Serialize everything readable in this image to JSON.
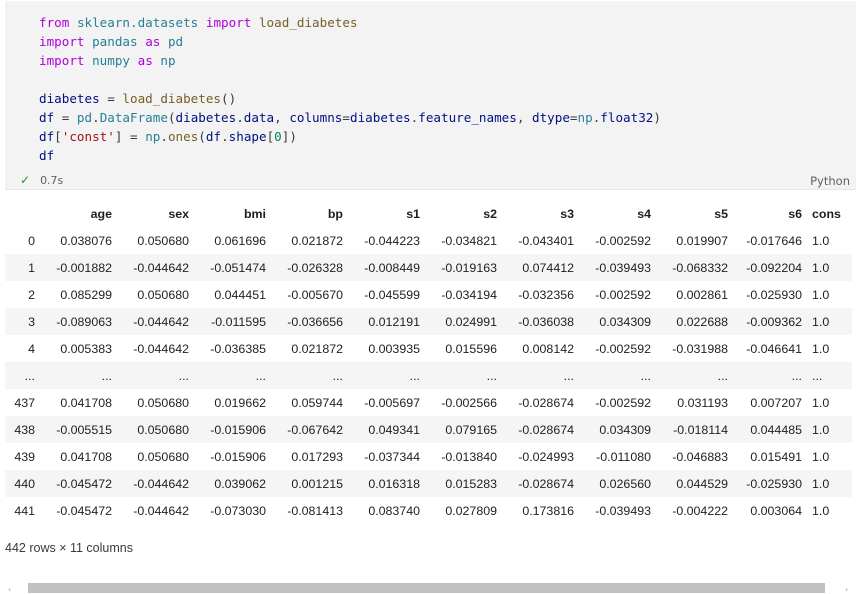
{
  "code_cell": {
    "lines": [
      "from sklearn.datasets import load_diabetes",
      "import pandas as pd",
      "import numpy as np",
      "",
      "diabetes = load_diabetes()",
      "df = pd.DataFrame(diabetes.data, columns=diabetes.feature_names, dtype=np.float32)",
      "df['const'] = np.ones(df.shape[0])",
      "df"
    ],
    "exec_time": "0.7s",
    "language": "Python"
  },
  "table": {
    "columns": [
      "age",
      "sex",
      "bmi",
      "bp",
      "s1",
      "s2",
      "s3",
      "s4",
      "s5",
      "s6",
      "cons"
    ],
    "rows": [
      [
        "0",
        "0.038076",
        "0.050680",
        "0.061696",
        "0.021872",
        "-0.044223",
        "-0.034821",
        "-0.043401",
        "-0.002592",
        "0.019907",
        "-0.017646",
        "1.0"
      ],
      [
        "1",
        "-0.001882",
        "-0.044642",
        "-0.051474",
        "-0.026328",
        "-0.008449",
        "-0.019163",
        "0.074412",
        "-0.039493",
        "-0.068332",
        "-0.092204",
        "1.0"
      ],
      [
        "2",
        "0.085299",
        "0.050680",
        "0.044451",
        "-0.005670",
        "-0.045599",
        "-0.034194",
        "-0.032356",
        "-0.002592",
        "0.002861",
        "-0.025930",
        "1.0"
      ],
      [
        "3",
        "-0.089063",
        "-0.044642",
        "-0.011595",
        "-0.036656",
        "0.012191",
        "0.024991",
        "-0.036038",
        "0.034309",
        "0.022688",
        "-0.009362",
        "1.0"
      ],
      [
        "4",
        "0.005383",
        "-0.044642",
        "-0.036385",
        "0.021872",
        "0.003935",
        "0.015596",
        "0.008142",
        "-0.002592",
        "-0.031988",
        "-0.046641",
        "1.0"
      ],
      [
        "...",
        "...",
        "...",
        "...",
        "...",
        "...",
        "...",
        "...",
        "...",
        "...",
        "...",
        "..."
      ],
      [
        "437",
        "0.041708",
        "0.050680",
        "0.019662",
        "0.059744",
        "-0.005697",
        "-0.002566",
        "-0.028674",
        "-0.002592",
        "0.031193",
        "0.007207",
        "1.0"
      ],
      [
        "438",
        "-0.005515",
        "0.050680",
        "-0.015906",
        "-0.067642",
        "0.049341",
        "0.079165",
        "-0.028674",
        "0.034309",
        "-0.018114",
        "0.044485",
        "1.0"
      ],
      [
        "439",
        "0.041708",
        "0.050680",
        "-0.015906",
        "0.017293",
        "-0.037344",
        "-0.013840",
        "-0.024993",
        "-0.011080",
        "-0.046883",
        "0.015491",
        "1.0"
      ],
      [
        "440",
        "-0.045472",
        "-0.044642",
        "0.039062",
        "0.001215",
        "0.016318",
        "0.015283",
        "-0.028674",
        "0.026560",
        "0.044529",
        "-0.025930",
        "1.0"
      ],
      [
        "441",
        "-0.045472",
        "-0.044642",
        "-0.073030",
        "-0.081413",
        "0.083740",
        "0.027809",
        "0.173816",
        "-0.039493",
        "-0.004222",
        "0.003064",
        "1.0"
      ]
    ],
    "summary": "442 rows × 11 columns"
  },
  "scrollbar": {
    "left_arrow": "‹",
    "right_arrow": "›"
  },
  "icons": {
    "status": "check-icon"
  }
}
